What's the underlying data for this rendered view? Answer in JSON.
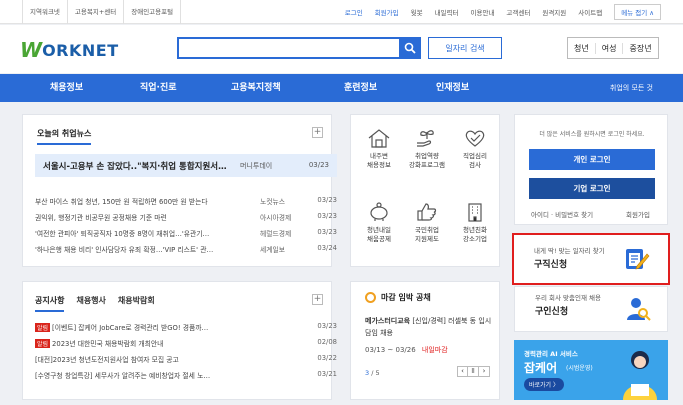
{
  "top_links": [
    "지역워크넷",
    "고용복지+센터",
    "장애인고용포털"
  ],
  "top_right": [
    "로그인",
    "회원가입",
    "웟봇",
    "내일력터",
    "이용안내",
    "고객센터",
    "원격지원",
    "사이트맵"
  ],
  "menu_button": "메뉴 접기 ∧",
  "logo": {
    "mark": "W",
    "text": "ORKNET"
  },
  "search": {
    "placeholder": "",
    "job_search_label": "일자리 검색"
  },
  "audience": [
    "청년",
    "여성",
    "중장년"
  ],
  "nav": [
    "채용정보",
    "직업·진로",
    "고용복지정책",
    "훈련정보",
    "인재정보"
  ],
  "nav_right": "취업의 모든 것",
  "news": {
    "title": "오늘의 취업뉴스",
    "headline": {
      "title": "서울시-고용부 손 잡았다..\"복지·취업 통합지원서…",
      "source": "머니투데이",
      "date": "03/23"
    },
    "items": [
      {
        "title": "부산 마이스 취업 청년, 150만 원 적립하면 600만 원 받는다",
        "source": "노컷뉴스",
        "date": "03/23"
      },
      {
        "title": "권익위, 행정기관 비공무원 공정채용 기준 마련",
        "source": "아시아경제",
        "date": "03/23"
      },
      {
        "title": "'여전한 관피아' 퇴직공직자 10명중 8명이 재취업…'유관기…",
        "source": "헤럴드경제",
        "date": "03/23"
      },
      {
        "title": "'하나은행 채용 비리' 인사담당자 유죄 확정…'VIP 리스트' 관…",
        "source": "세계일보",
        "date": "03/24"
      }
    ]
  },
  "notice": {
    "tabs": [
      "공지사항",
      "채용행사",
      "채용박람회"
    ],
    "items": [
      {
        "badge": "알림",
        "title": "[이벤트] 잡케어 JobCare로 경력관리 받GO! 경품까…",
        "date": "03/23"
      },
      {
        "badge": "알림",
        "title": "2023년 대한민국 채용박람회 개최안내",
        "date": "02/08"
      },
      {
        "badge": "",
        "title": "[대전]2023년 청년도전지원사업 참여자 모집 공고",
        "date": "03/22"
      },
      {
        "badge": "",
        "title": "[수영구청 창업특강] 세무사가 알려주는 예비창업자 절세 노…",
        "date": "03/21"
      }
    ]
  },
  "services": [
    {
      "label1": "내주변",
      "label2": "채용정보",
      "icon": "house-icon"
    },
    {
      "label1": "취업역량",
      "label2": "강화프로그램",
      "icon": "seedling-hand-icon"
    },
    {
      "label1": "직업심리",
      "label2": "검사",
      "icon": "heart-check-icon"
    },
    {
      "label1": "청년내일",
      "label2": "채움공제",
      "icon": "piggy-bank-icon"
    },
    {
      "label1": "국민취업",
      "label2": "지원제도",
      "icon": "thumbs-up-icon"
    },
    {
      "label1": "청년친화",
      "label2": "강소기업",
      "icon": "building-icon"
    }
  ],
  "deadline": {
    "title": "마감 임박 공채",
    "company": "메가스터디교육",
    "desc": "[신입/경력] 러셀북 동 입시담임 채용",
    "period": "03/13 ~ 03/26",
    "status": "내일마감",
    "page": "3",
    "total": "/ 5"
  },
  "login_panel": {
    "message": "더 많은 서비스를 원하시면 로그인 하세요.",
    "personal": "개인 로그인",
    "company": "기업 로그인",
    "find": "아이디 · 비밀번호 찾기",
    "join": "회원가입"
  },
  "job_request": {
    "sub": "내게 딱! 맞는 일자리 찾기",
    "main": "구직신청"
  },
  "hire_request": {
    "sub": "우리 회사 맞춤인재 채용",
    "main": "구인신청"
  },
  "banner": {
    "line1": "경력관리 AI 서비스",
    "line2": "잡케어",
    "line3": "(시범운영)",
    "button": "바로가기 〉"
  },
  "colors": {
    "brand_blue": "#2a6bd6",
    "highlight_red": "#e01e1e",
    "green": "#4aa534"
  }
}
